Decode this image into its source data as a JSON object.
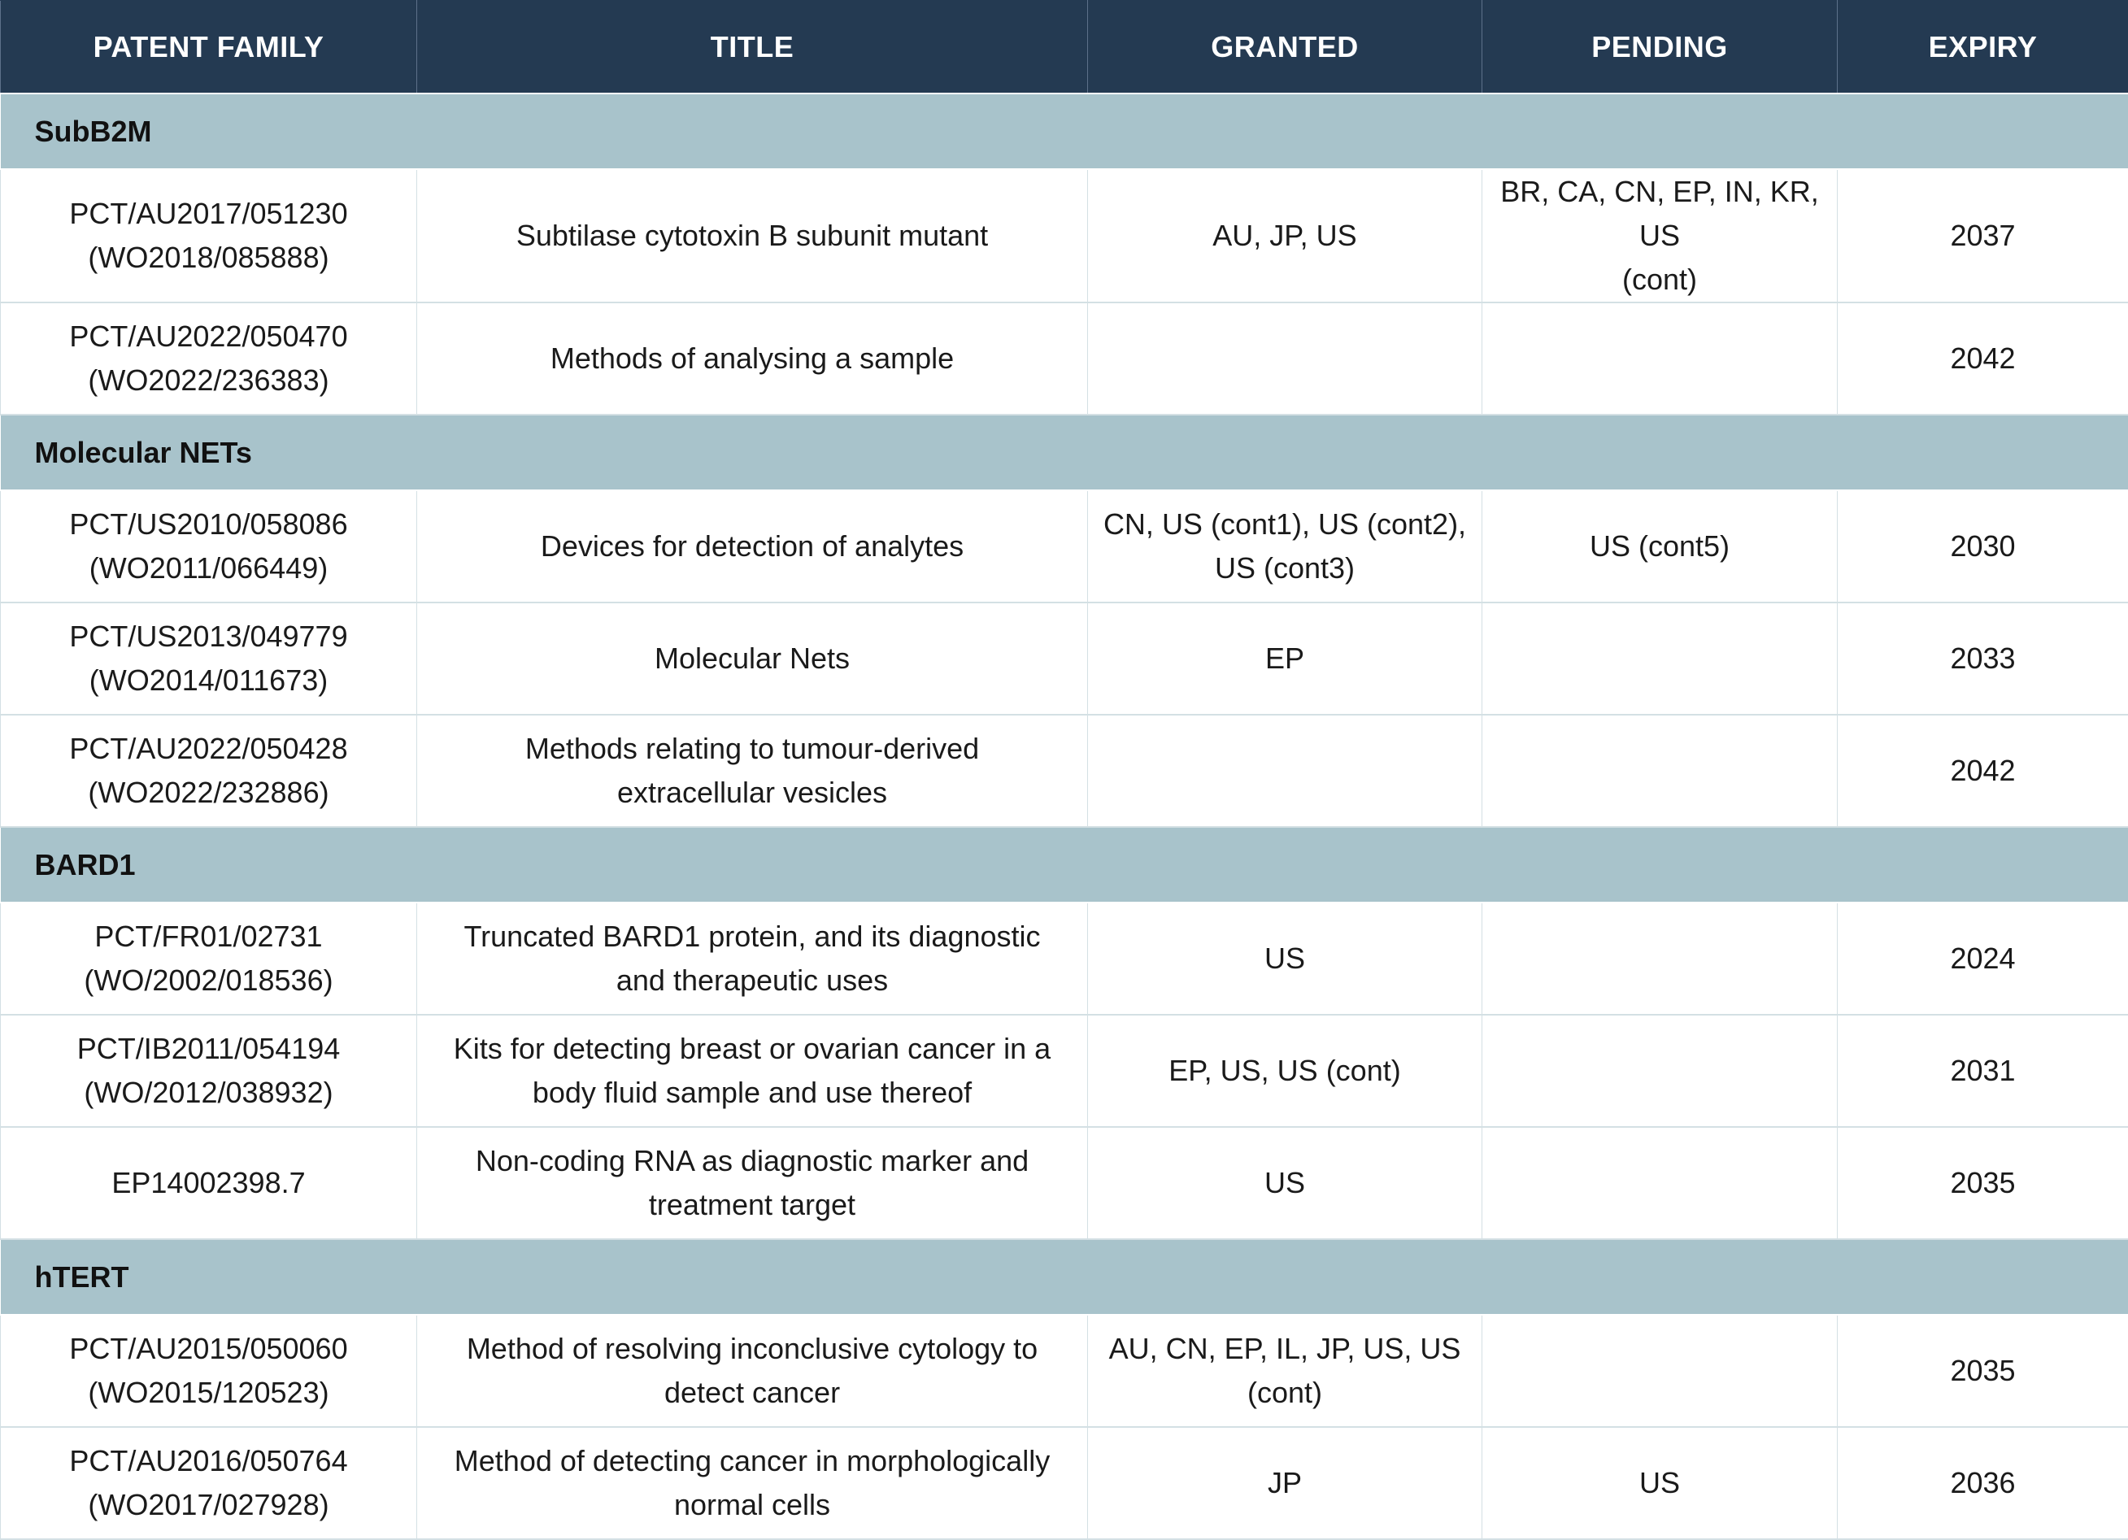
{
  "headers": {
    "patent_family": "PATENT FAMILY",
    "title": "TITLE",
    "granted": "GRANTED",
    "pending": "PENDING",
    "expiry": "EXPIRY"
  },
  "groups": [
    {
      "name": "SubB2M",
      "rows": [
        {
          "family": "PCT/AU2017/051230\n(WO2018/085888)",
          "title": "Subtilase cytotoxin B subunit mutant",
          "granted": "AU, JP, US",
          "pending": "BR, CA, CN, EP, IN, KR, US\n(cont)",
          "expiry": "2037"
        },
        {
          "family": "PCT/AU2022/050470\n(WO2022/236383)",
          "title": "Methods of analysing a sample",
          "granted": "",
          "pending": "",
          "expiry": "2042"
        }
      ]
    },
    {
      "name": "Molecular NETs",
      "rows": [
        {
          "family": "PCT/US2010/058086\n(WO2011/066449)",
          "title": "Devices for detection of analytes",
          "granted": "CN, US (cont1), US (cont2),\nUS (cont3)",
          "pending": "US (cont5)",
          "expiry": "2030"
        },
        {
          "family": "PCT/US2013/049779\n(WO2014/011673)",
          "title": "Molecular Nets",
          "granted": "EP",
          "pending": "",
          "expiry": "2033"
        },
        {
          "family": "PCT/AU2022/050428\n(WO2022/232886)",
          "title": "Methods relating to tumour-derived\nextracellular vesicles",
          "granted": "",
          "pending": "",
          "expiry": "2042"
        }
      ]
    },
    {
      "name": "BARD1",
      "rows": [
        {
          "family": "PCT/FR01/02731\n(WO/2002/018536)",
          "title": "Truncated BARD1 protein, and its diagnostic\nand therapeutic uses",
          "granted": "US",
          "pending": "",
          "expiry": "2024"
        },
        {
          "family": "PCT/IB2011/054194\n(WO/2012/038932)",
          "title": "Kits for detecting breast or ovarian cancer in a\nbody fluid sample and use thereof",
          "granted": "EP, US, US (cont)",
          "pending": "",
          "expiry": "2031"
        },
        {
          "family": "EP14002398.7",
          "title": "Non-coding RNA as diagnostic marker and\ntreatment target",
          "granted": "US",
          "pending": "",
          "expiry": "2035"
        }
      ]
    },
    {
      "name": "hTERT",
      "rows": [
        {
          "family": "PCT/AU2015/050060\n(WO2015/120523)",
          "title": "Method of resolving inconclusive cytology to\ndetect cancer",
          "granted": "AU, CN, EP, IL, JP, US, US\n(cont)",
          "pending": "",
          "expiry": "2035"
        },
        {
          "family": "PCT/AU2016/050764\n(WO2017/027928)",
          "title": "Method of detecting cancer in morphologically\nnormal cells",
          "granted": "JP",
          "pending": "US",
          "expiry": "2036"
        }
      ]
    }
  ]
}
